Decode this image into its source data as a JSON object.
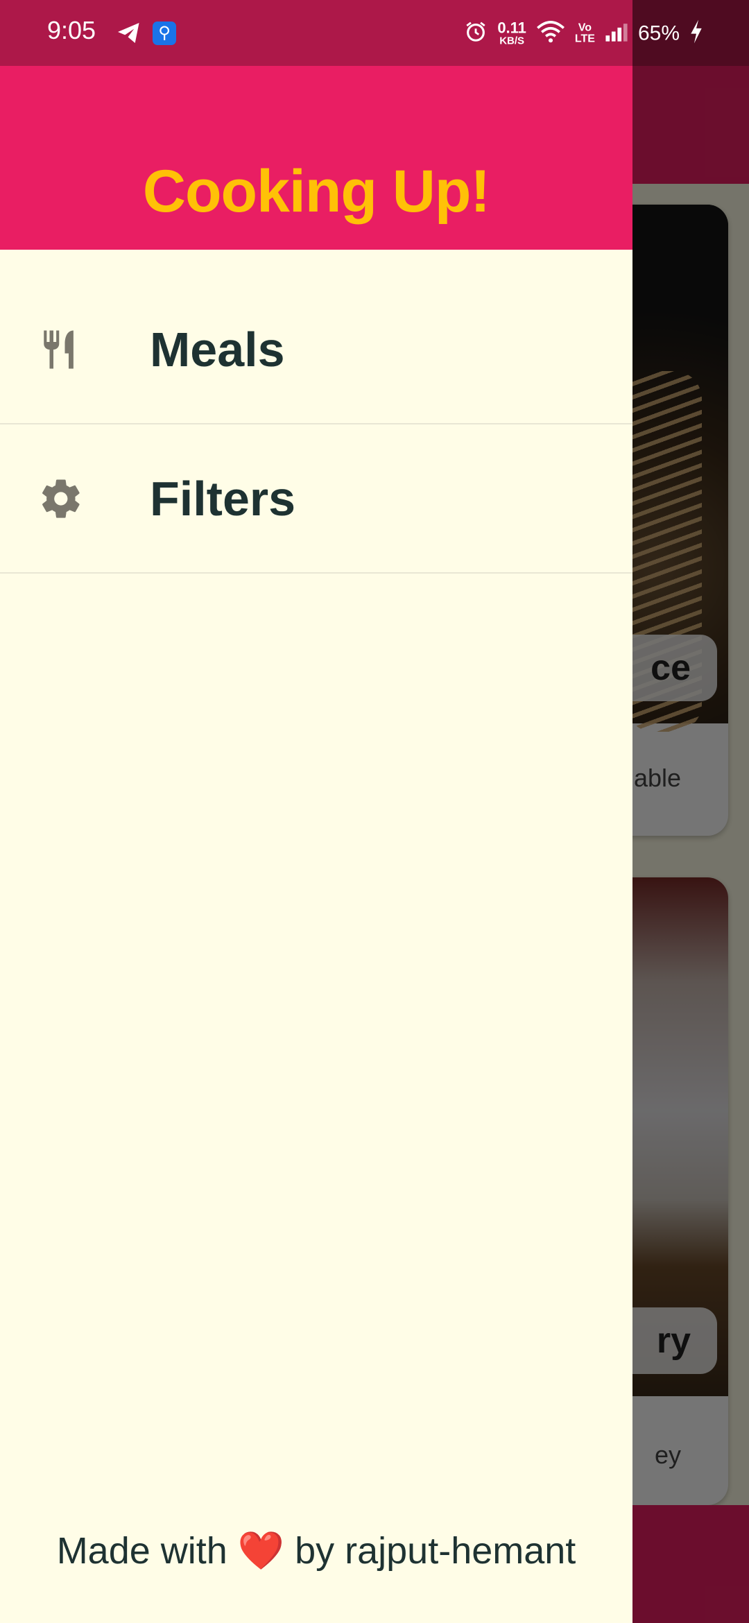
{
  "status_bar": {
    "time": "9:05",
    "icons": [
      "telegram-icon",
      "usb-debug-icon",
      "alarm-icon",
      "wifi-icon",
      "volte-icon",
      "signal-icon",
      "charging-icon"
    ],
    "net_speed_value": "0.11",
    "net_speed_unit": "KB/S",
    "volte_line1": "Vo",
    "volte_line2": "LTE",
    "battery": "65%"
  },
  "drawer": {
    "title": "Cooking Up!",
    "items": [
      {
        "label": "Meals",
        "icon": "restaurant-icon"
      },
      {
        "label": "Filters",
        "icon": "settings-icon"
      }
    ],
    "footer": {
      "prefix": "Made with",
      "heart": "❤️",
      "suffix": "by rajput-hemant"
    }
  },
  "background": {
    "cards": [
      {
        "title_fragment": "ce",
        "subtitle_fragment": "able"
      },
      {
        "title_fragment": "ry",
        "subtitle_fragment": "ey"
      }
    ]
  },
  "colors": {
    "primary": "#e91e63",
    "status_bar": "#ad1849",
    "accent": "#ffc107",
    "canvas": "#fffde7",
    "text_dark": "#1e3232"
  }
}
